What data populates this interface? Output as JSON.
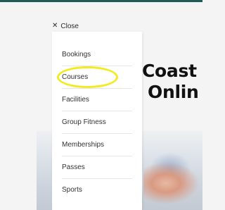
{
  "close": {
    "icon": "close-icon",
    "label": "Close"
  },
  "menu": {
    "items": [
      "Bookings",
      "Courses",
      "Facilities",
      "Group Fitness",
      "Memberships",
      "Passes",
      "Sports"
    ],
    "highlighted": "Courses",
    "highlight_color": "#f3ea23"
  },
  "hero": {
    "line1": "Coast",
    "line2": "Onlin"
  },
  "colors": {
    "accent_bar": "#1f5c57"
  }
}
